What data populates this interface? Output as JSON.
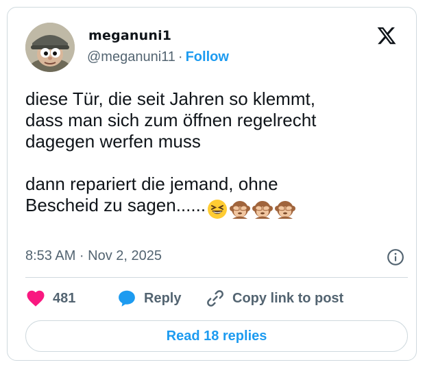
{
  "tweet": {
    "author": {
      "display_name": "meganuni1",
      "handle": "@meganuni11",
      "separator": "·",
      "follow_label": "Follow",
      "avatar_icon": "helmet-character-avatar"
    },
    "platform_icon": "x-logo-icon",
    "text_paragraph_1": "diese Tür, die seit Jahren so klemmt,\ndass man sich zum öffnen regelrecht\ndagegen werfen muss",
    "text_paragraph_2": "dann repariert die jemand, ohne\nBescheid zu sagen......",
    "emojis": [
      "grinning-squinting-face",
      "see-no-evil-monkey",
      "see-no-evil-monkey",
      "see-no-evil-monkey"
    ],
    "timestamp": "8:53 AM · Nov 2, 2025",
    "info_icon": "info-icon"
  },
  "actions": {
    "like_count": "481",
    "reply_label": "Reply",
    "copy_link_label": "Copy link to post"
  },
  "read_replies_label": "Read 18 replies",
  "colors": {
    "accent": "#1d9bf0",
    "like": "#f91880",
    "text": "#0f1419",
    "muted": "#536471",
    "border": "#cfd9de"
  }
}
